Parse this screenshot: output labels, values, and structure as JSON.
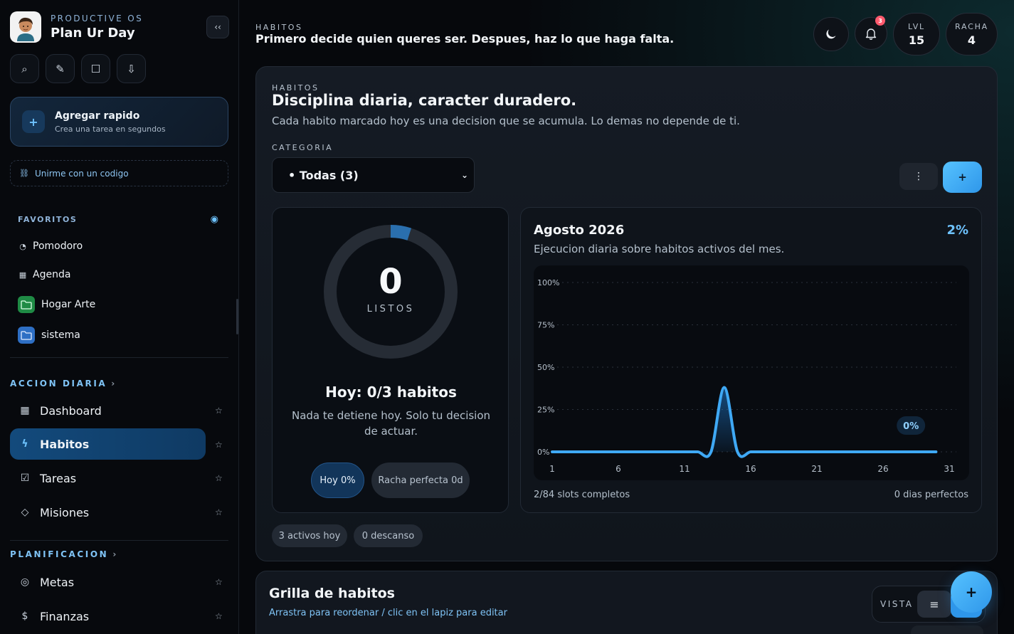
{
  "sidebar": {
    "brand_kicker": "PRODUCTIVE OS",
    "brand_title": "Plan Ur Day",
    "collapse_label": "‹‹",
    "tools": [
      {
        "icon": "search-icon",
        "glyph": "⌕"
      },
      {
        "icon": "pencil-icon",
        "glyph": "✎"
      },
      {
        "icon": "square-icon",
        "glyph": "☐"
      },
      {
        "icon": "download-icon",
        "glyph": "⇩"
      }
    ],
    "quick_add": {
      "title": "Agregar rapido",
      "subtitle": "Crea una tarea en segundos",
      "icon": "+"
    },
    "join_code": {
      "label": "Unirme con un codigo",
      "icon": "⛓"
    },
    "favorites": {
      "label": "FAVORITOS",
      "items": [
        {
          "label": "Pomodoro",
          "icon": "clock-icon",
          "glyph": "◔"
        },
        {
          "label": "Agenda",
          "icon": "calendar-icon",
          "glyph": "▦"
        },
        {
          "label": "Hogar Arte",
          "icon": "folder-icon",
          "color": "#3cc46a"
        },
        {
          "label": "sistema",
          "icon": "folder-icon",
          "color": "#3e8ef0"
        }
      ]
    },
    "section_daily": {
      "label": "ACCION DIARIA",
      "items": [
        {
          "label": "Dashboard",
          "icon": "dashboard-icon",
          "glyph": "▦"
        },
        {
          "label": "Habitos",
          "icon": "bolt-icon",
          "glyph": "ϟ",
          "active": true
        },
        {
          "label": "Tareas",
          "icon": "checkbox-icon",
          "glyph": "☑"
        },
        {
          "label": "Misiones",
          "icon": "diamond-icon",
          "glyph": "◇"
        }
      ]
    },
    "section_planning": {
      "label": "PLANIFICACION",
      "items": [
        {
          "label": "Metas",
          "icon": "target-icon",
          "glyph": "◎"
        },
        {
          "label": "Finanzas",
          "icon": "dollar-icon",
          "glyph": "$"
        }
      ]
    }
  },
  "header": {
    "kicker": "HABITOS",
    "quote": "Primero decide quien queres ser. Despues, haz lo que haga falta.",
    "notifications_count": "3",
    "level": {
      "label": "LVL",
      "value": "15"
    },
    "streak": {
      "label": "RACHA",
      "value": "4"
    }
  },
  "habits_card": {
    "kicker": "HABITOS",
    "title": "Disciplina diaria, caracter duradero.",
    "subtitle": "Cada habito marcado hoy es una decision que se acumula. Lo demas no depende de ti.",
    "category_label": "CATEGORIA",
    "category_value": "• Todas (3)",
    "more_label": "⋮",
    "add_label": "+",
    "today": {
      "count": "0",
      "count_label": "LISTOS",
      "progress_fraction": 0.05,
      "title": "Hoy: 0/3 habitos",
      "message": "Nada te detiene hoy. Solo tu decision de actuar.",
      "pill_today": "Hoy 0%",
      "pill_streak": "Racha perfecta 0d"
    },
    "month": {
      "title": "Agosto 2026",
      "percent": "2%",
      "subtitle": "Ejecucion diaria sobre habitos activos del mes.",
      "footer_left": "2/84 slots completos",
      "footer_right": "0 dias perfectos"
    },
    "chips": {
      "active": "3 activos hoy",
      "rest": "0 descanso"
    }
  },
  "grid_card": {
    "title": "Grilla de habitos",
    "subtitle": "Arrastra para reordenar / clic en el lapiz para editar",
    "view_label": "VISTA",
    "fab_label": "+"
  },
  "colors": {
    "accent": "#3fa9f5",
    "accent_light": "#6ec3ff",
    "active_nav": "#134a7c"
  },
  "chart_data": {
    "type": "area",
    "x": [
      1,
      2,
      3,
      4,
      5,
      6,
      7,
      8,
      9,
      10,
      11,
      12,
      13,
      14,
      15,
      16,
      17,
      18,
      19,
      20,
      21,
      22,
      23,
      24,
      25,
      26,
      27,
      28,
      29,
      30,
      31
    ],
    "values": [
      0,
      0,
      0,
      0,
      0,
      0,
      0,
      0,
      0,
      0,
      0,
      0,
      0,
      38,
      0,
      0,
      0,
      0,
      0,
      0,
      0,
      0,
      0,
      0,
      0,
      0,
      0,
      0,
      0,
      0,
      0
    ],
    "x_ticks": [
      "1",
      "6",
      "11",
      "16",
      "21",
      "26",
      "31"
    ],
    "y_ticks": [
      "0%",
      "25%",
      "50%",
      "75%",
      "100%"
    ],
    "ylim": [
      0,
      100
    ],
    "current_label": "0%",
    "grid": true
  }
}
